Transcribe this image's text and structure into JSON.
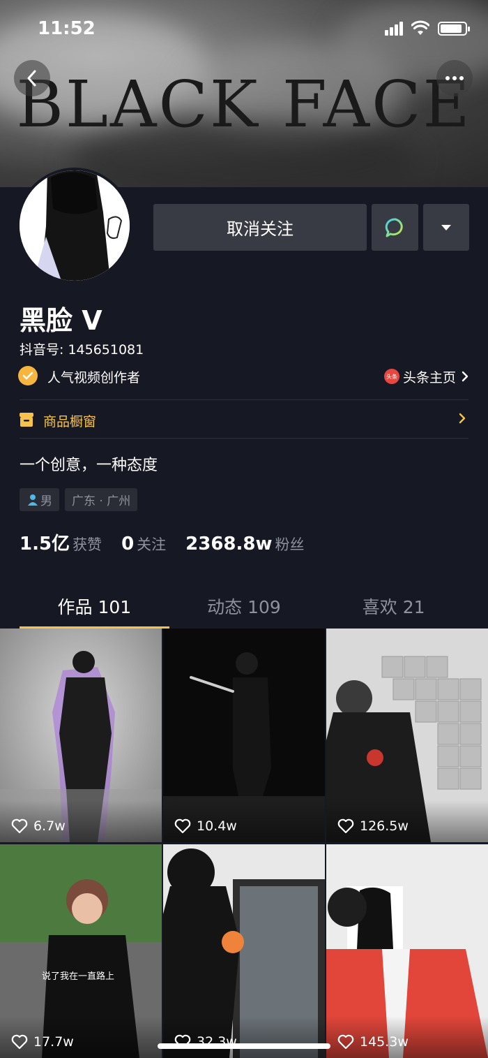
{
  "status_bar": {
    "time": "11:52"
  },
  "header": {
    "banner_text": "BLACK  FACE"
  },
  "profile": {
    "name": "黑脸 V",
    "douyin_id": "抖音号: 145651081",
    "certification": "人气视频创作者",
    "toutiao_link": "头条主页",
    "toutiao_badge": "头条",
    "shop_label": "商品橱窗",
    "bio": "一个创意，一种态度",
    "tags": [
      "男",
      "广东 · 广州"
    ]
  },
  "actions": {
    "unfollow_label": "取消关注"
  },
  "stats": [
    {
      "value": "1.5亿",
      "label": "获赞"
    },
    {
      "value": "0",
      "label": "关注"
    },
    {
      "value": "2368.8w",
      "label": "粉丝"
    }
  ],
  "tabs": [
    {
      "label": "作品 101",
      "active": true
    },
    {
      "label": "动态 109",
      "active": false
    },
    {
      "label": "喜欢 21",
      "active": false
    }
  ],
  "videos": [
    {
      "likes": "6.7w"
    },
    {
      "likes": "10.4w"
    },
    {
      "likes": "126.5w"
    },
    {
      "likes": "17.7w",
      "caption": "说了我在一直路上"
    },
    {
      "likes": "32.3w"
    },
    {
      "likes": "145.3w"
    }
  ],
  "colors": {
    "background": "#161823",
    "accent": "#f5c34b",
    "button": "#393b44",
    "muted": "#8f929c"
  }
}
